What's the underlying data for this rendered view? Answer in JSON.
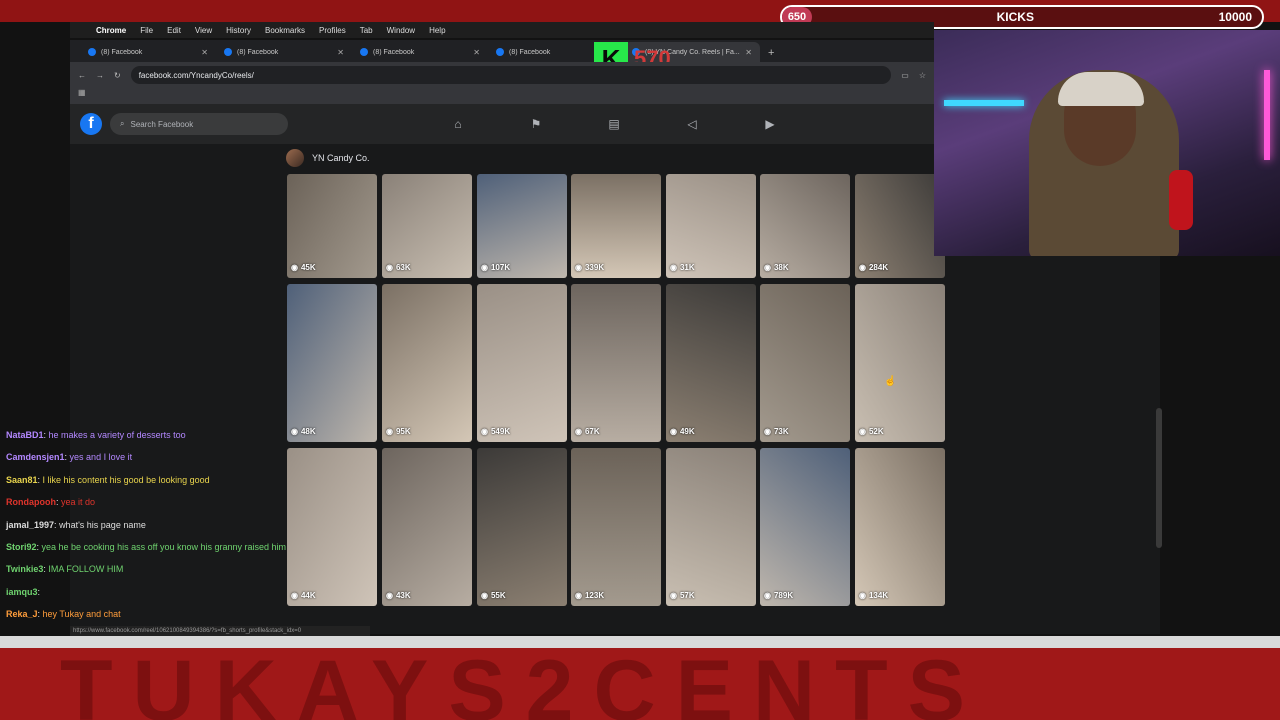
{
  "overlay": {
    "kicks_goal_pill": "650",
    "kicks_label": "KICKS",
    "kicks_target": "10000",
    "kick_logo": "K",
    "kick_counter": "570",
    "banner_text": "TUKAYS2CENTS"
  },
  "menubar": {
    "app": "Chrome",
    "items": [
      "File",
      "Edit",
      "View",
      "History",
      "Bookmarks",
      "Profiles",
      "Tab",
      "Window",
      "Help"
    ]
  },
  "tabs": [
    {
      "label": "(8) Facebook",
      "active": false
    },
    {
      "label": "(8) Facebook",
      "active": false
    },
    {
      "label": "(8) Facebook",
      "active": false
    },
    {
      "label": "(8) Facebook",
      "active": false
    },
    {
      "label": "(8) YN Candy Co. Reels | Fa...",
      "active": true
    }
  ],
  "address": {
    "url": "facebook.com/YncandyCo/reels/"
  },
  "facebook": {
    "search_placeholder": "Search Facebook",
    "page_name": "YN Candy Co."
  },
  "reels": {
    "row1": [
      "45K",
      "63K",
      "107K",
      "339K",
      "31K",
      "38K",
      "284K"
    ],
    "row2": [
      "48K",
      "95K",
      "549K",
      "67K",
      "49K",
      "73K",
      "52K"
    ],
    "row3": [
      "44K",
      "43K",
      "55K",
      "123K",
      "57K",
      "789K",
      "134K"
    ]
  },
  "chat": [
    {
      "user": "NataBD1",
      "text": "he makes a variety of desserts too",
      "color": "#b388ff"
    },
    {
      "user": "Camdensjen1",
      "text": "yes and I love it",
      "color": "#b388ff"
    },
    {
      "user": "Saan81",
      "text": "I like his content his good be looking good",
      "color": "#e8d44d"
    },
    {
      "user": "Rondapooh",
      "text": "yea it do",
      "color": "#e0342c"
    },
    {
      "user": "jamal_1997",
      "text": "what's his page name",
      "color": "#dddddd"
    },
    {
      "user": "Stori92",
      "text": "yea he be cooking his ass off you know his granny raised him",
      "color": "#6fd36f"
    },
    {
      "user": "Twinkie3",
      "text": "IMA FOLLOW HIM",
      "color": "#6fd36f"
    },
    {
      "user": "iamqu3",
      "text": "",
      "color": "#6fd36f"
    },
    {
      "user": "Reka_J",
      "text": "hey Tukay and chat",
      "color": "#ff9d3b"
    }
  ],
  "status_url": "https://www.facebook.com/reel/1062100849394386/?s=fb_shorts_profile&stack_idx=0"
}
